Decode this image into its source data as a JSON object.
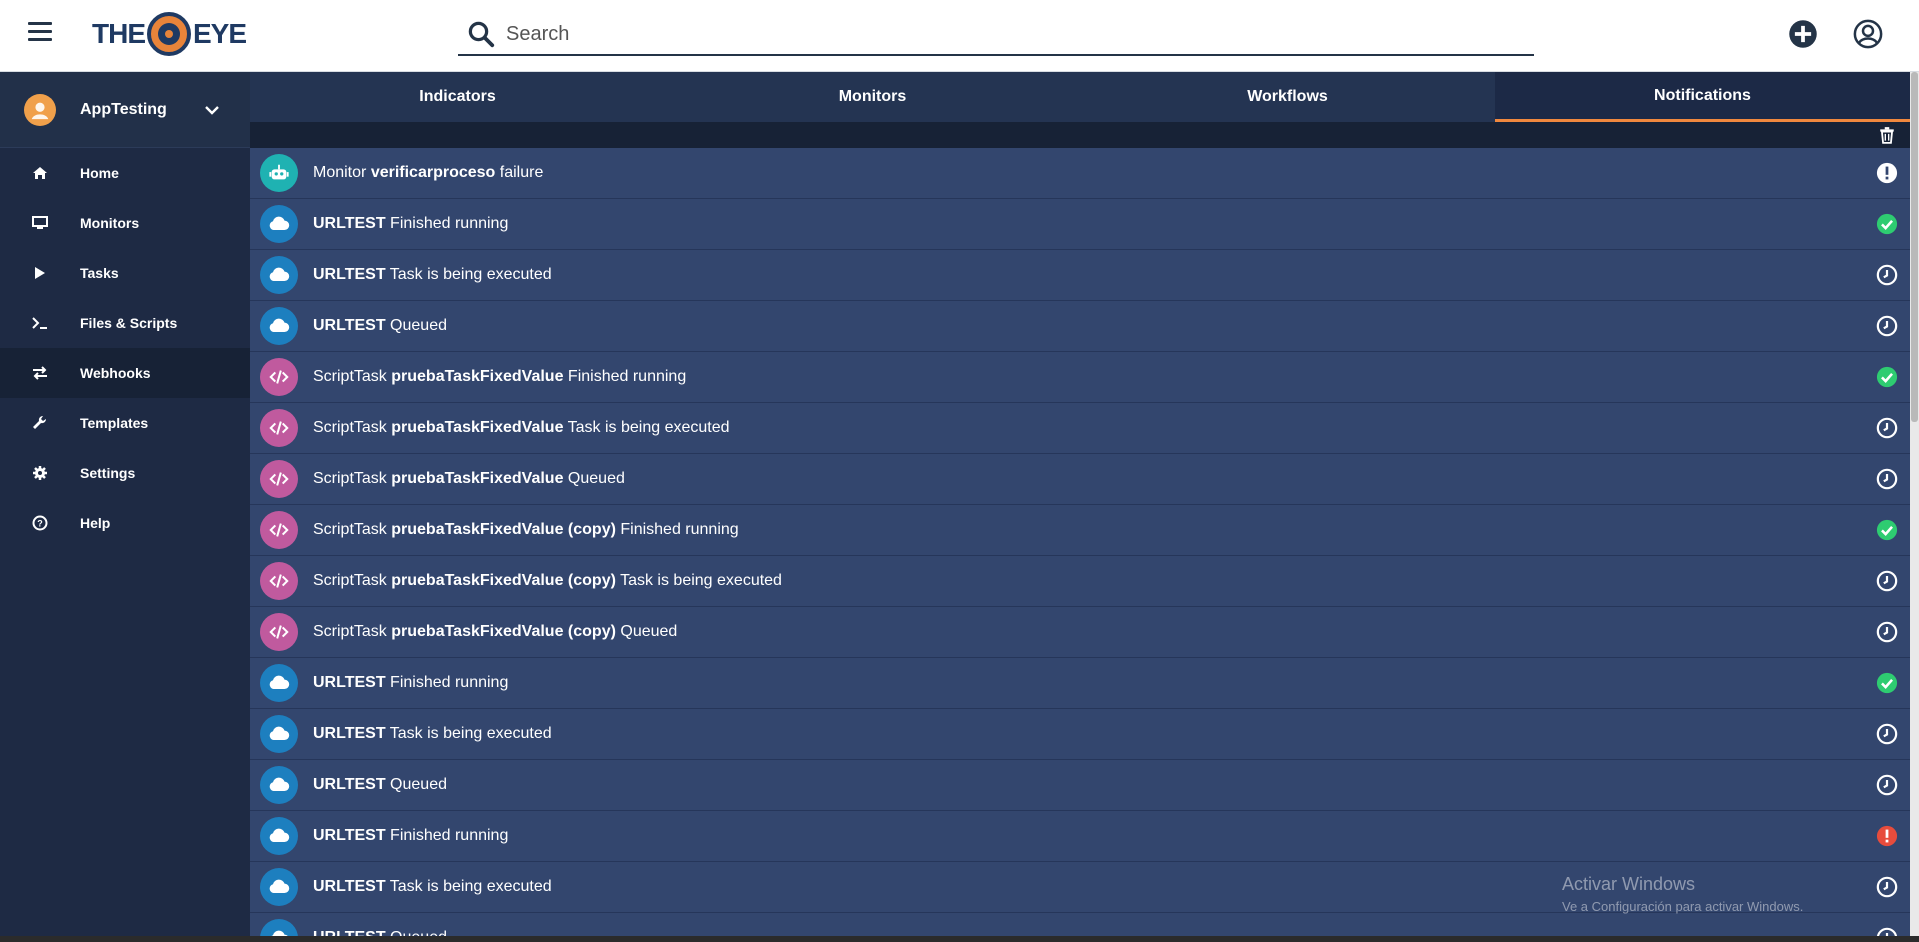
{
  "header": {
    "logo_left": "THE",
    "logo_right": "EYE",
    "search_placeholder": "Search"
  },
  "sidebar": {
    "org_name": "AppTesting",
    "items": [
      {
        "label": "Home",
        "icon": "home-icon"
      },
      {
        "label": "Monitors",
        "icon": "monitor-icon"
      },
      {
        "label": "Tasks",
        "icon": "play-icon"
      },
      {
        "label": "Files & Scripts",
        "icon": "terminal-icon"
      },
      {
        "label": "Webhooks",
        "icon": "exchange-icon"
      },
      {
        "label": "Templates",
        "icon": "wrench-icon"
      },
      {
        "label": "Settings",
        "icon": "gear-icon"
      },
      {
        "label": "Help",
        "icon": "help-icon"
      }
    ]
  },
  "tabs": [
    {
      "label": "Indicators"
    },
    {
      "label": "Monitors"
    },
    {
      "label": "Workflows"
    },
    {
      "label": "Notifications",
      "active": true
    }
  ],
  "notifications": [
    {
      "type": "robot",
      "prefix": "Monitor",
      "name": "verificarproceso",
      "suffix": "failure",
      "status": "alert-white"
    },
    {
      "type": "cloud",
      "prefix": "",
      "name": "URLTEST",
      "suffix": "Finished running",
      "status": "success"
    },
    {
      "type": "cloud",
      "prefix": "",
      "name": "URLTEST",
      "suffix": "Task is being executed",
      "status": "clock"
    },
    {
      "type": "cloud",
      "prefix": "",
      "name": "URLTEST",
      "suffix": "Queued",
      "status": "clock"
    },
    {
      "type": "code",
      "prefix": "ScriptTask",
      "name": "pruebaTaskFixedValue",
      "suffix": "Finished running",
      "status": "success"
    },
    {
      "type": "code",
      "prefix": "ScriptTask",
      "name": "pruebaTaskFixedValue",
      "suffix": "Task is being executed",
      "status": "clock"
    },
    {
      "type": "code",
      "prefix": "ScriptTask",
      "name": "pruebaTaskFixedValue",
      "suffix": "Queued",
      "status": "clock"
    },
    {
      "type": "code",
      "prefix": "ScriptTask",
      "name": "pruebaTaskFixedValue (copy)",
      "suffix": "Finished running",
      "status": "success"
    },
    {
      "type": "code",
      "prefix": "ScriptTask",
      "name": "pruebaTaskFixedValue (copy)",
      "suffix": "Task is being executed",
      "status": "clock"
    },
    {
      "type": "code",
      "prefix": "ScriptTask",
      "name": "pruebaTaskFixedValue (copy)",
      "suffix": "Queued",
      "status": "clock"
    },
    {
      "type": "cloud",
      "prefix": "",
      "name": "URLTEST",
      "suffix": "Finished running",
      "status": "success"
    },
    {
      "type": "cloud",
      "prefix": "",
      "name": "URLTEST",
      "suffix": "Task is being executed",
      "status": "clock"
    },
    {
      "type": "cloud",
      "prefix": "",
      "name": "URLTEST",
      "suffix": "Queued",
      "status": "clock"
    },
    {
      "type": "cloud",
      "prefix": "",
      "name": "URLTEST",
      "suffix": "Finished running",
      "status": "error"
    },
    {
      "type": "cloud",
      "prefix": "",
      "name": "URLTEST",
      "suffix": "Task is being executed",
      "status": "clock"
    },
    {
      "type": "cloud",
      "prefix": "",
      "name": "URLTEST",
      "suffix": "Queued",
      "status": "clock"
    }
  ],
  "watermark": {
    "title": "Activar Windows",
    "subtitle": "Ve a Configuración para activar Windows."
  },
  "colors": {
    "accent": "#f0883e",
    "success": "#2ecc71",
    "error": "#e74c3c"
  }
}
